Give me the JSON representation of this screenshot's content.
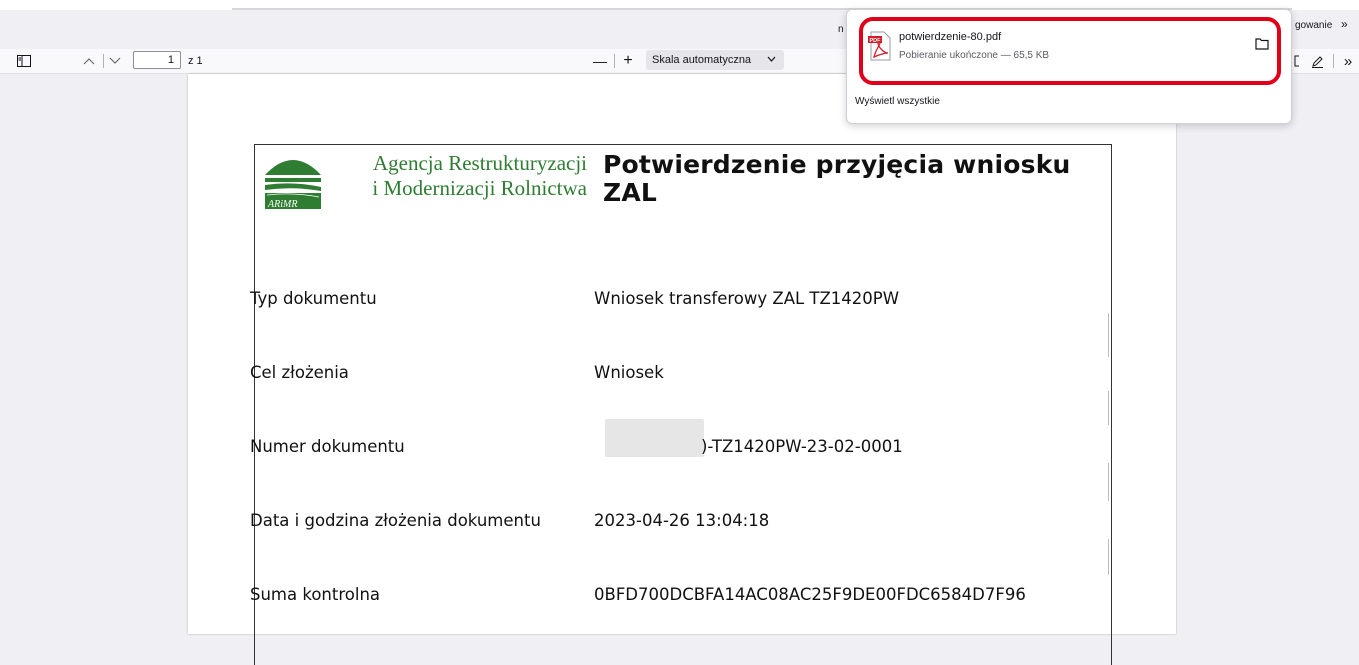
{
  "toolbar": {
    "page_number": "1",
    "page_total": "z 1",
    "zoom_out": "—",
    "zoom_in": "+",
    "scale_value": "Skala automatyczna",
    "right_label": "gowanie",
    "overflow": "»"
  },
  "download": {
    "filename": "potwierdzenie-80.pdf",
    "status": "Pobieranie ukończone — 65,5 KB",
    "show_all": "Wyświetl wszystkie",
    "behind_text": "n"
  },
  "document": {
    "agency_line1": "Agencja Restrukturyzacji",
    "agency_line2": "i Modernizacji Rolnictwa",
    "logo_text": "ARiMR",
    "title": "Potwierdzenie przyjęcia wniosku ZAL",
    "rows": [
      {
        "label": "Typ dokumentu",
        "value": "Wniosek transferowy ZAL TZ1420PW"
      },
      {
        "label": "Cel złożenia",
        "value": "Wniosek"
      },
      {
        "label": "Numer dokumentu",
        "value": ")-TZ1420PW-23-02-0001"
      },
      {
        "label": "Data i godzina złożenia dokumentu",
        "value": "2023-04-26 13:04:18"
      },
      {
        "label": "Suma kontrolna",
        "value": "0BFD700DCBFA14AC08AC25F9DE00FDC6584D7F96"
      }
    ]
  },
  "colors": {
    "highlight": "#e0001a",
    "agency_green": "#2e7d32"
  }
}
